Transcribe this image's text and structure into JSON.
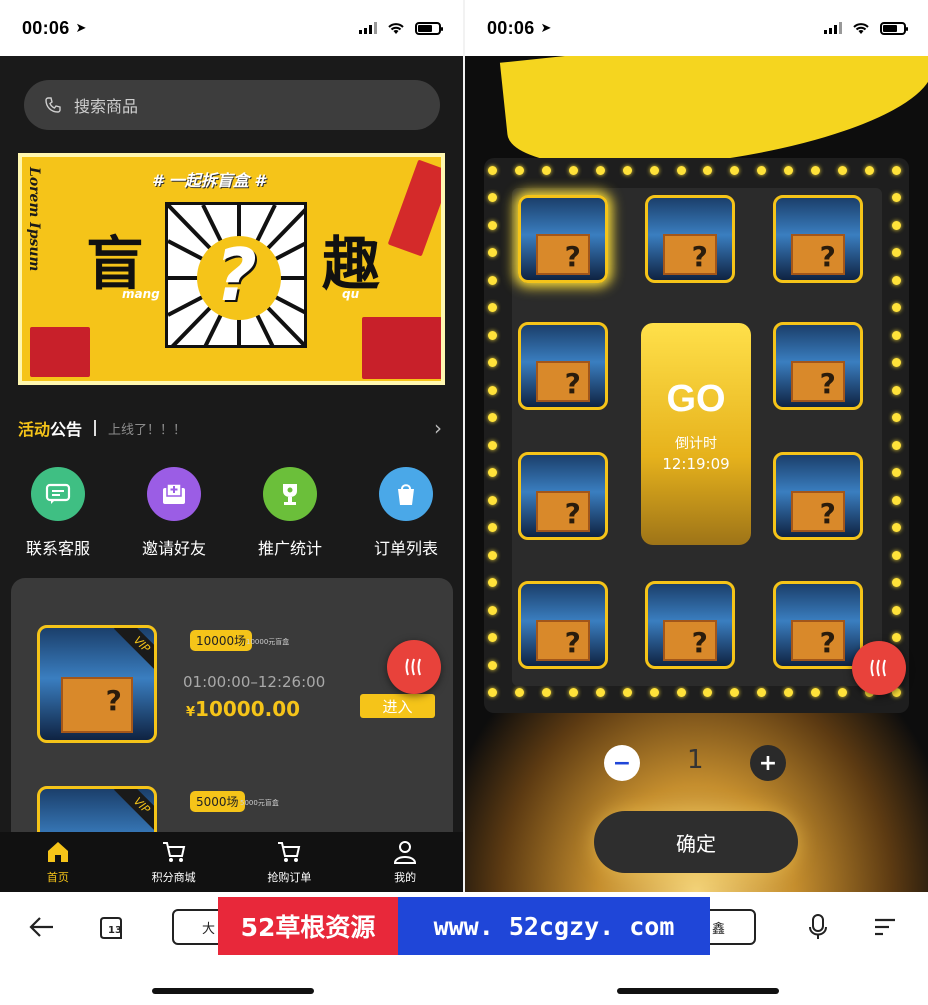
{
  "left": {
    "status": {
      "time": "00:06"
    },
    "search": {
      "placeholder": "搜索商品"
    },
    "banner": {
      "side_text": "Lorem Ipsum",
      "tagline": "# 一起拆盲盒 #",
      "char_left": "盲",
      "pinyin_left": "mang",
      "char_right": "趣",
      "pinyin_right": "qu",
      "question": "?"
    },
    "notice": {
      "title_yellow": "活动",
      "title_white": "公告",
      "message": "上线了！！！"
    },
    "menu": [
      {
        "label": "联系客服",
        "icon": "chat-icon",
        "color": "#3fbf83"
      },
      {
        "label": "邀请好友",
        "icon": "invite-mail-icon",
        "color": "#9b5de5"
      },
      {
        "label": "推广统计",
        "icon": "trophy-icon",
        "color": "#6bbf3a"
      },
      {
        "label": "订单列表",
        "icon": "bag-icon",
        "color": "#4aa8e8"
      }
    ],
    "sessions": [
      {
        "badge": "VIP",
        "tag": "10000场",
        "tag_note": "10000元盲盒",
        "time": "01:00:00–12:26:00",
        "currency": "¥",
        "price": "10000.00",
        "enter": "进入"
      },
      {
        "badge": "VIP",
        "tag": "5000场",
        "tag_note": "5000元盲盒"
      }
    ],
    "tabs": [
      {
        "label": "首页",
        "icon": "home-icon",
        "active": true
      },
      {
        "label": "积分商城",
        "icon": "cart-icon",
        "active": false
      },
      {
        "label": "抢购订单",
        "icon": "cart-icon",
        "active": false
      },
      {
        "label": "我的",
        "icon": "user-icon",
        "active": false
      }
    ]
  },
  "right": {
    "status": {
      "time": "00:06"
    },
    "go": {
      "label": "GO",
      "countdown_label": "倒计时",
      "countdown": "12:19:09"
    },
    "quantity": {
      "minus": "−",
      "value": "1",
      "plus": "+"
    },
    "confirm": "确定"
  },
  "browser": {
    "url_left": "大",
    "url_right": "鑫",
    "tab_count": "13",
    "watermark_cn": "52草根资源",
    "watermark_url": "www. 52cgzy. com"
  },
  "colors": {
    "accent": "#f5c419",
    "fab": "#e8423b",
    "dark": "#1a1a1a"
  }
}
